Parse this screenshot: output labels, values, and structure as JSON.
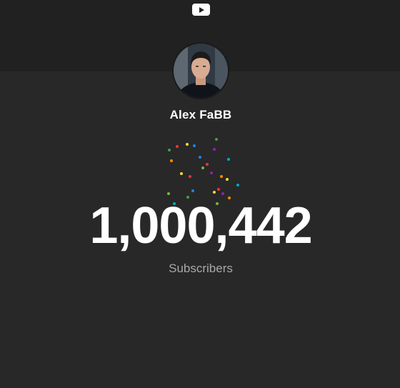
{
  "header": {
    "logo_icon": "youtube-play-icon",
    "background": "#212121"
  },
  "channel": {
    "name": "Alex FaBB",
    "avatar_icon": "profile-photo"
  },
  "stats": {
    "subscriber_count": "1,000,442",
    "subscriber_label": "Subscribers"
  },
  "colors": {
    "page_background": "#282828",
    "count_text": "#ffffff",
    "label_text": "#a8a8a8",
    "confetti": [
      "#e53935",
      "#43a047",
      "#1e88e5",
      "#fdd835",
      "#8e24aa",
      "#fb8c00",
      "#00acc1",
      "#7cb342"
    ]
  }
}
